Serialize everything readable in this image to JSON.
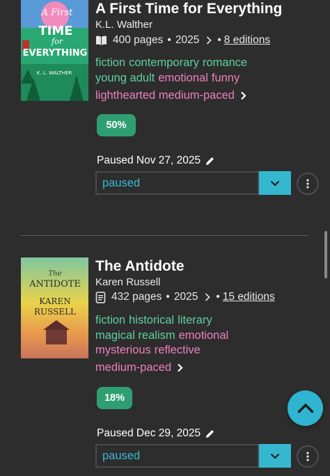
{
  "books": [
    {
      "title": "A First Time for Everything",
      "author": "K.L. Walther",
      "pages": "400 pages",
      "year": "2025",
      "editions": "8 editions",
      "tags_green": [
        "fiction",
        "contemporary",
        "romance",
        "young adult"
      ],
      "tags_pink": [
        "emotional",
        "funny"
      ],
      "moods": "lighthearted medium-paced",
      "progress": "50%",
      "paused_label": "Paused Nov 27, 2025",
      "status": "paused",
      "cover": {
        "title_line1": "A First",
        "title_line2": "TIME",
        "title_line3": "for",
        "title_line4": "EVERYTHING",
        "author": "K. L. WALTHER"
      }
    },
    {
      "title": "The Antidote",
      "author": "Karen Russell",
      "pages": "432 pages",
      "year": "2025",
      "editions": "15 editions",
      "tags_green": [
        "fiction",
        "historical",
        "literary",
        "magical realism"
      ],
      "tags_pink": [
        "emotional",
        "mysterious",
        "reflective",
        "medium-paced"
      ],
      "progress": "18%",
      "paused_label": "Paused Dec 29, 2025",
      "status": "paused",
      "cover": {
        "the": "The",
        "title": "ANTIDOTE",
        "author_line1": "KAREN",
        "author_line2": "RUSSELL"
      }
    }
  ],
  "colors": {
    "background": "#2d2d2d",
    "green_tag": "#5fd0a1",
    "pink_tag": "#ef7fbe",
    "accent": "#35b7d0",
    "progress_pill": "#2f9f73"
  },
  "icons": [
    "book-icon",
    "document-icon",
    "chevron-right-icon",
    "pencil-icon",
    "chevron-down-icon",
    "more-vertical-icon",
    "chevron-up-icon"
  ]
}
